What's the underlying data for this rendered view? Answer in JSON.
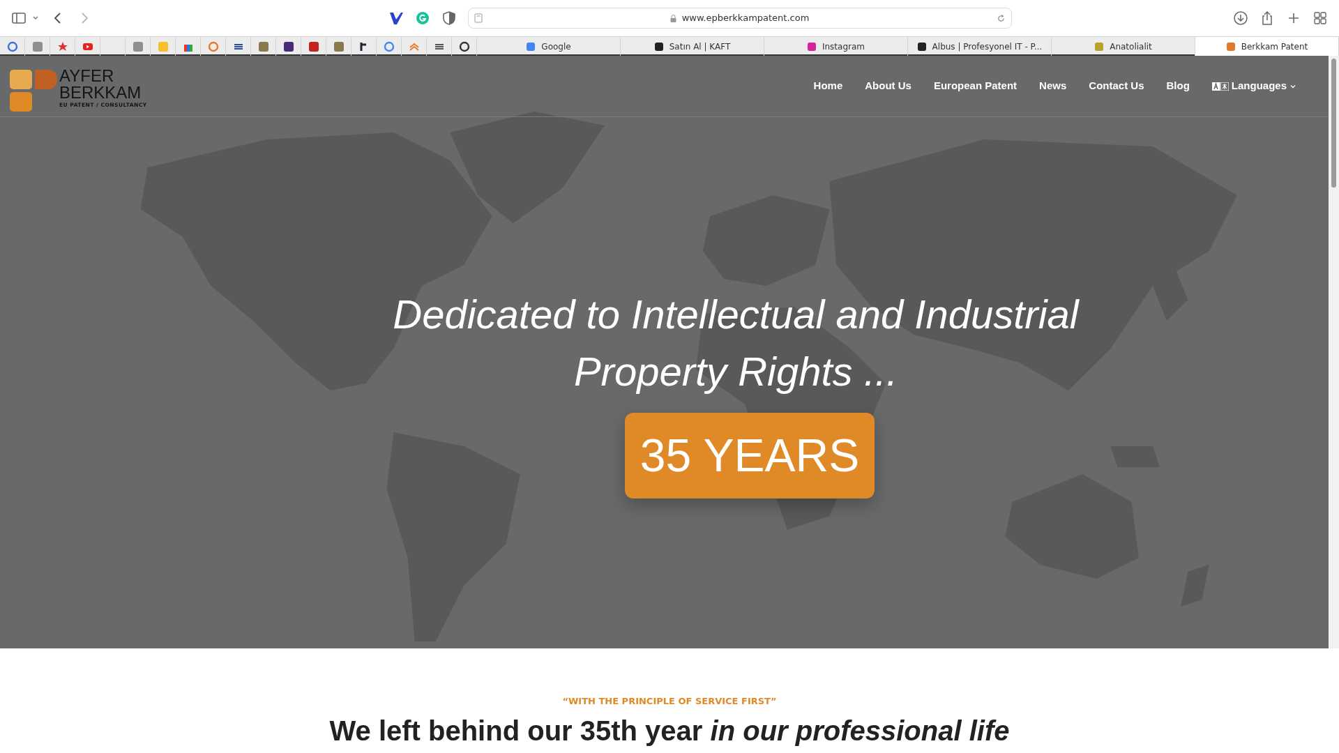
{
  "browser": {
    "url": "www.epberkkampatent.com"
  },
  "tabs": [
    {
      "label": "Google",
      "selected": false
    },
    {
      "label": "Satın Al | KAFT",
      "selected": false
    },
    {
      "label": "Instagram",
      "selected": false
    },
    {
      "label": "Albus | Profesyonel IT - P...",
      "selected": false
    },
    {
      "label": "Anatolialit",
      "selected": false
    },
    {
      "label": "Berkkam Patent",
      "selected": true
    }
  ],
  "logo": {
    "line1": "AYFER",
    "line2": "BERKKAM",
    "tagline": "EU PATENT / CONSULTANCY"
  },
  "nav": [
    {
      "label": "Home",
      "kind": "link"
    },
    {
      "label": "About Us",
      "kind": "link"
    },
    {
      "label": "European Patent",
      "kind": "link"
    },
    {
      "label": "News",
      "kind": "link"
    },
    {
      "label": "Contact Us",
      "kind": "link"
    },
    {
      "label": "Blog",
      "kind": "link"
    },
    {
      "label": "Languages",
      "kind": "dropdown"
    }
  ],
  "hero": {
    "title": "Dedicated to Intellectual and Industrial Property Rights ...",
    "badge": "35 YEARS"
  },
  "section": {
    "eyebrow": "“WITH THE PRINCIPLE OF SERVICE FIRST”",
    "heading": "We left behind our 35th year *in our professional life*"
  }
}
